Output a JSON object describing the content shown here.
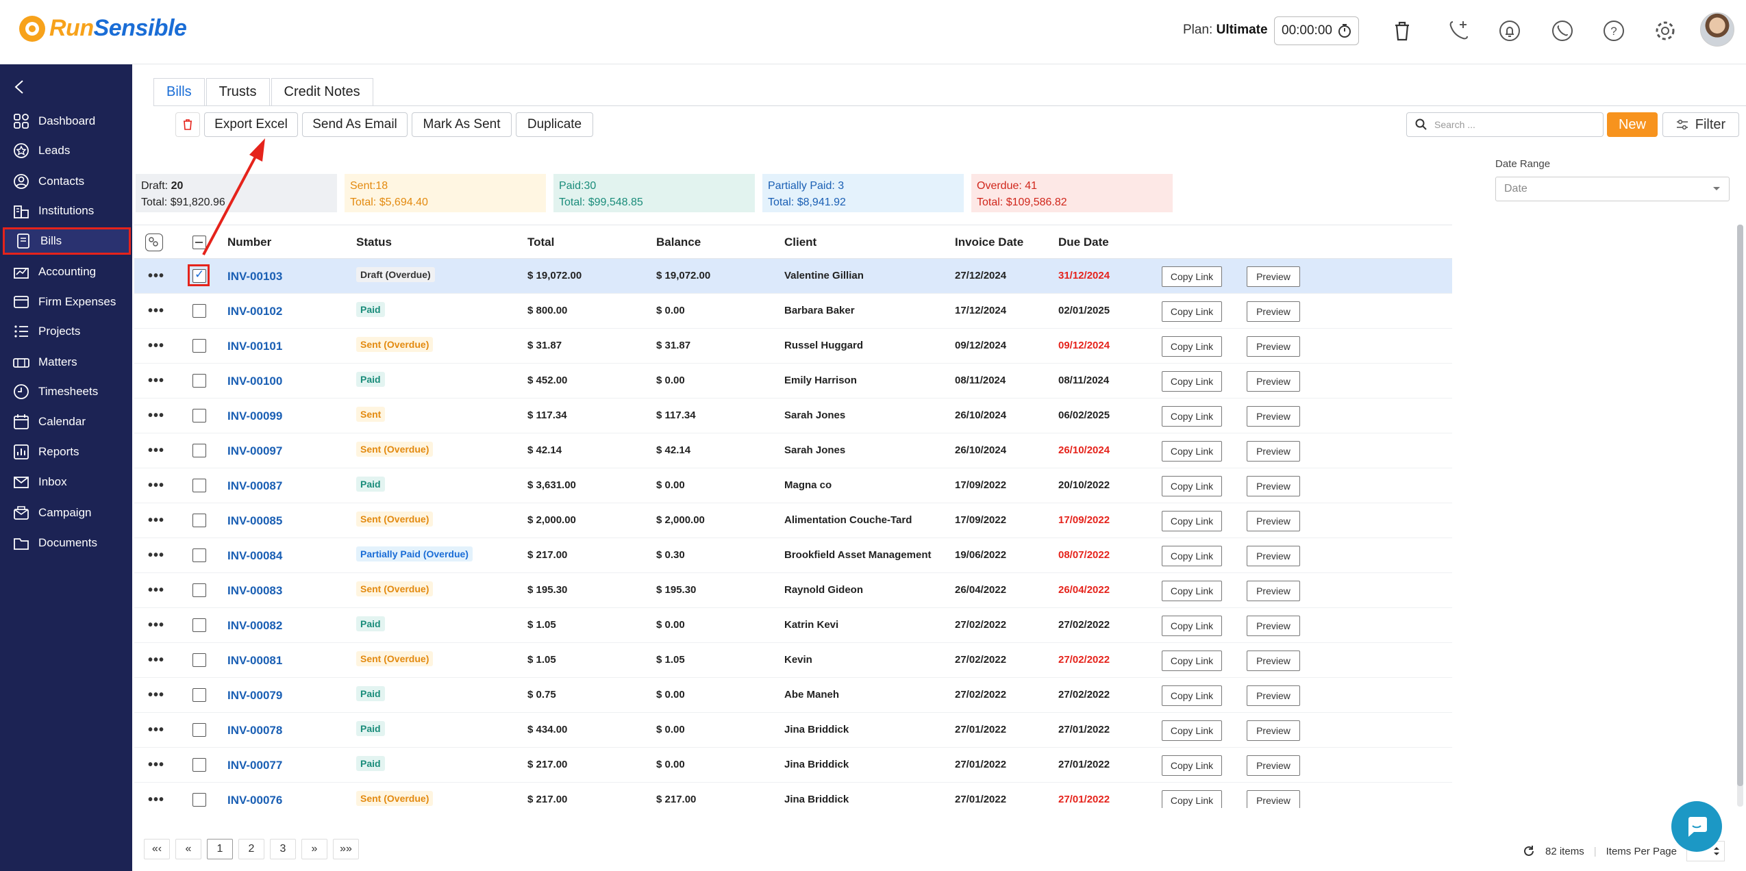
{
  "app": {
    "logo_run": "Run",
    "logo_sensible": "Sensible",
    "plan_label": "Plan:",
    "plan_value": "Ultimate",
    "timer": "00:00:00"
  },
  "topbar_icons": [
    "trash-icon",
    "add-call-icon",
    "notification-bell-icon",
    "phone-icon",
    "help-icon",
    "settings-gear-icon"
  ],
  "sidebar": {
    "items": [
      {
        "label": "Dashboard",
        "icon": "dashboard-icon"
      },
      {
        "label": "Leads",
        "icon": "leads-icon"
      },
      {
        "label": "Contacts",
        "icon": "contacts-icon"
      },
      {
        "label": "Institutions",
        "icon": "institutions-icon"
      },
      {
        "label": "Bills",
        "icon": "bills-icon"
      },
      {
        "label": "Accounting",
        "icon": "accounting-icon"
      },
      {
        "label": "Firm Expenses",
        "icon": "firm-expenses-icon"
      },
      {
        "label": "Projects",
        "icon": "projects-icon"
      },
      {
        "label": "Matters",
        "icon": "matters-icon"
      },
      {
        "label": "Timesheets",
        "icon": "timesheets-icon"
      },
      {
        "label": "Calendar",
        "icon": "calendar-icon"
      },
      {
        "label": "Reports",
        "icon": "reports-icon"
      },
      {
        "label": "Inbox",
        "icon": "inbox-icon"
      },
      {
        "label": "Campaign",
        "icon": "campaign-icon"
      },
      {
        "label": "Documents",
        "icon": "documents-icon"
      }
    ],
    "active": "Bills"
  },
  "tabs": [
    {
      "label": "Bills",
      "active": true
    },
    {
      "label": "Trusts",
      "active": false
    },
    {
      "label": "Credit Notes",
      "active": false
    }
  ],
  "toolbar": {
    "export_excel": "Export Excel",
    "send_as_email": "Send As Email",
    "mark_as_sent": "Mark As Sent",
    "duplicate": "Duplicate",
    "search_placeholder": "Search ...",
    "new": "New",
    "filter": "Filter"
  },
  "stats": {
    "draft": {
      "label": "Draft:",
      "count": "20",
      "total": "Total: $91,820.96",
      "bg": "#eef0f3",
      "color": "#222"
    },
    "sent": {
      "label": "Sent:18",
      "total": "Total: $5,694.40",
      "bg": "#fff6e2",
      "color": "#e38a10"
    },
    "paid": {
      "label": "Paid:30",
      "total": "Total: $99,548.85",
      "bg": "#e2f3ef",
      "color": "#1a8c7a"
    },
    "partial": {
      "label": "Partially Paid: 3",
      "total": "Total: $8,941.92",
      "bg": "#e4f2fc",
      "color": "#1a5fb4"
    },
    "overdue": {
      "label": "Overdue: 41",
      "total": "Total: $109,586.82",
      "bg": "#fde8e6",
      "color": "#d0261b"
    }
  },
  "date_range": {
    "label": "Date Range",
    "placeholder": "Date"
  },
  "table": {
    "headers": [
      "Number",
      "Status",
      "Total",
      "Balance",
      "Client",
      "Invoice Date",
      "Due Date"
    ],
    "copy_link": "Copy Link",
    "preview": "Preview",
    "rows": [
      {
        "number": "INV-00103",
        "status": "Draft (Overdue)",
        "kind": "draft",
        "total": "$ 19,072.00",
        "balance": "$ 19,072.00",
        "client": "Valentine Gillian",
        "invoice_date": "27/12/2024",
        "due_date": "31/12/2024",
        "overdue": true,
        "checked": true
      },
      {
        "number": "INV-00102",
        "status": "Paid",
        "kind": "paid",
        "total": "$ 800.00",
        "balance": "$ 0.00",
        "client": "Barbara Baker",
        "invoice_date": "17/12/2024",
        "due_date": "02/01/2025",
        "overdue": false,
        "checked": false
      },
      {
        "number": "INV-00101",
        "status": "Sent (Overdue)",
        "kind": "sent",
        "total": "$ 31.87",
        "balance": "$ 31.87",
        "client": "Russel Huggard",
        "invoice_date": "09/12/2024",
        "due_date": "09/12/2024",
        "overdue": true,
        "checked": false
      },
      {
        "number": "INV-00100",
        "status": "Paid",
        "kind": "paid",
        "total": "$ 452.00",
        "balance": "$ 0.00",
        "client": "Emily Harrison",
        "invoice_date": "08/11/2024",
        "due_date": "08/11/2024",
        "overdue": false,
        "checked": false
      },
      {
        "number": "INV-00099",
        "status": "Sent",
        "kind": "sent",
        "total": "$ 117.34",
        "balance": "$ 117.34",
        "client": "Sarah Jones",
        "invoice_date": "26/10/2024",
        "due_date": "06/02/2025",
        "overdue": false,
        "checked": false
      },
      {
        "number": "INV-00097",
        "status": "Sent (Overdue)",
        "kind": "sent",
        "total": "$ 42.14",
        "balance": "$ 42.14",
        "client": "Sarah Jones",
        "invoice_date": "26/10/2024",
        "due_date": "26/10/2024",
        "overdue": true,
        "checked": false
      },
      {
        "number": "INV-00087",
        "status": "Paid",
        "kind": "paid",
        "total": "$ 3,631.00",
        "balance": "$ 0.00",
        "client": "Magna co",
        "invoice_date": "17/09/2022",
        "due_date": "20/10/2022",
        "overdue": false,
        "checked": false
      },
      {
        "number": "INV-00085",
        "status": "Sent (Overdue)",
        "kind": "sent",
        "total": "$ 2,000.00",
        "balance": "$ 2,000.00",
        "client": "Alimentation Couche-Tard",
        "invoice_date": "17/09/2022",
        "due_date": "17/09/2022",
        "overdue": true,
        "checked": false
      },
      {
        "number": "INV-00084",
        "status": "Partially Paid (Overdue)",
        "kind": "partial",
        "total": "$ 217.00",
        "balance": "$ 0.30",
        "client": "Brookfield Asset Management",
        "invoice_date": "19/06/2022",
        "due_date": "08/07/2022",
        "overdue": true,
        "checked": false
      },
      {
        "number": "INV-00083",
        "status": "Sent (Overdue)",
        "kind": "sent",
        "total": "$ 195.30",
        "balance": "$ 195.30",
        "client": "Raynold Gideon",
        "invoice_date": "26/04/2022",
        "due_date": "26/04/2022",
        "overdue": true,
        "checked": false
      },
      {
        "number": "INV-00082",
        "status": "Paid",
        "kind": "paid",
        "total": "$ 1.05",
        "balance": "$ 0.00",
        "client": "Katrin Kevi",
        "invoice_date": "27/02/2022",
        "due_date": "27/02/2022",
        "overdue": false,
        "checked": false
      },
      {
        "number": "INV-00081",
        "status": "Sent (Overdue)",
        "kind": "sent",
        "total": "$ 1.05",
        "balance": "$ 1.05",
        "client": "Kevin",
        "invoice_date": "27/02/2022",
        "due_date": "27/02/2022",
        "overdue": true,
        "checked": false
      },
      {
        "number": "INV-00079",
        "status": "Paid",
        "kind": "paid",
        "total": "$ 0.75",
        "balance": "$ 0.00",
        "client": "Abe Maneh",
        "invoice_date": "27/02/2022",
        "due_date": "27/02/2022",
        "overdue": false,
        "checked": false
      },
      {
        "number": "INV-00078",
        "status": "Paid",
        "kind": "paid",
        "total": "$ 434.00",
        "balance": "$ 0.00",
        "client": "Jina Briddick",
        "invoice_date": "27/01/2022",
        "due_date": "27/01/2022",
        "overdue": false,
        "checked": false
      },
      {
        "number": "INV-00077",
        "status": "Paid",
        "kind": "paid",
        "total": "$ 217.00",
        "balance": "$ 0.00",
        "client": "Jina Briddick",
        "invoice_date": "27/01/2022",
        "due_date": "27/01/2022",
        "overdue": false,
        "checked": false
      },
      {
        "number": "INV-00076",
        "status": "Sent (Overdue)",
        "kind": "sent",
        "total": "$ 217.00",
        "balance": "$ 217.00",
        "client": "Jina Briddick",
        "invoice_date": "27/01/2022",
        "due_date": "27/01/2022",
        "overdue": true,
        "checked": false
      }
    ]
  },
  "pagination": {
    "first": "«‹",
    "prev": "«",
    "pages": [
      "1",
      "2",
      "3"
    ],
    "active_page": "1",
    "next": "»",
    "last": "»»",
    "items_count": "82 items",
    "items_per_page": "Items Per Page"
  },
  "colors": {
    "accent": "#1a6dd6",
    "brand_orange": "#f7931e",
    "sidebar": "#1c2354",
    "annotation": "#e5231b"
  }
}
